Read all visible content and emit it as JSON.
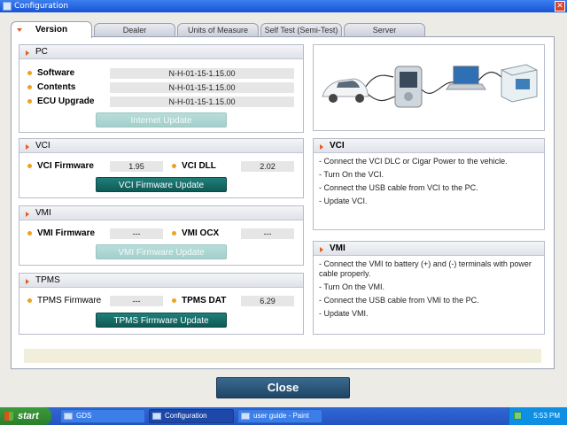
{
  "window": {
    "title": "Configuration",
    "close_glyph": "✕"
  },
  "tabs": [
    {
      "label": "Version",
      "active": true
    },
    {
      "label": "Dealer",
      "active": false
    },
    {
      "label": "Units of Measure",
      "active": false
    },
    {
      "label": "Self Test (Semi-Test)",
      "active": false
    },
    {
      "label": "Server",
      "active": false
    }
  ],
  "pc": {
    "title": "PC",
    "software_label": "Software",
    "software_value": "N-H-01-15-1.15.00",
    "contents_label": "Contents",
    "contents_value": "N-H-01-15-1.15.00",
    "ecu_label": "ECU Upgrade",
    "ecu_value": "N-H-01-15-1.15.00",
    "button": "Internet Update"
  },
  "vci": {
    "title": "VCI",
    "firmware_label": "VCI Firmware",
    "firmware_value": "1.95",
    "dll_label": "VCI DLL",
    "dll_value": "2.02",
    "button": "VCI Firmware Update"
  },
  "vmi": {
    "title": "VMI",
    "firmware_label": "VMI Firmware",
    "firmware_value": "---",
    "ocx_label": "VMI OCX",
    "ocx_value": "---",
    "button": "VMI Firmware Update"
  },
  "tpms": {
    "title": "TPMS",
    "firmware_label": "TPMS Firmware",
    "firmware_value": "---",
    "dat_label": "TPMS DAT",
    "dat_value": "6.29",
    "button": "TPMS Firmware Update"
  },
  "vci_info": {
    "title": "VCI",
    "lines": [
      "- Connect the VCI DLC or Cigar Power to the vehicle.",
      "- Turn On the VCI.",
      "- Connect the USB cable from VCI to the PC.",
      "- Update VCI."
    ]
  },
  "vmi_info": {
    "title": "VMI",
    "lines": [
      "- Connect the VMI to battery (+) and (-) terminals with power cable properly.",
      "- Turn On the VMI.",
      "- Connect the USB cable from VMI to the PC.",
      "- Update VMI."
    ]
  },
  "close_button": "Close",
  "taskbar": {
    "start": "start",
    "tasks": [
      {
        "label": "GDS",
        "active": false
      },
      {
        "label": "Configuration",
        "active": true
      },
      {
        "label": "user guide - Paint",
        "active": false
      }
    ],
    "clock": "5:53 PM"
  },
  "colors": {
    "accent_orange": "#e85a1b",
    "button_teal": "#0f5a56",
    "close_blue": "#1f4566"
  }
}
